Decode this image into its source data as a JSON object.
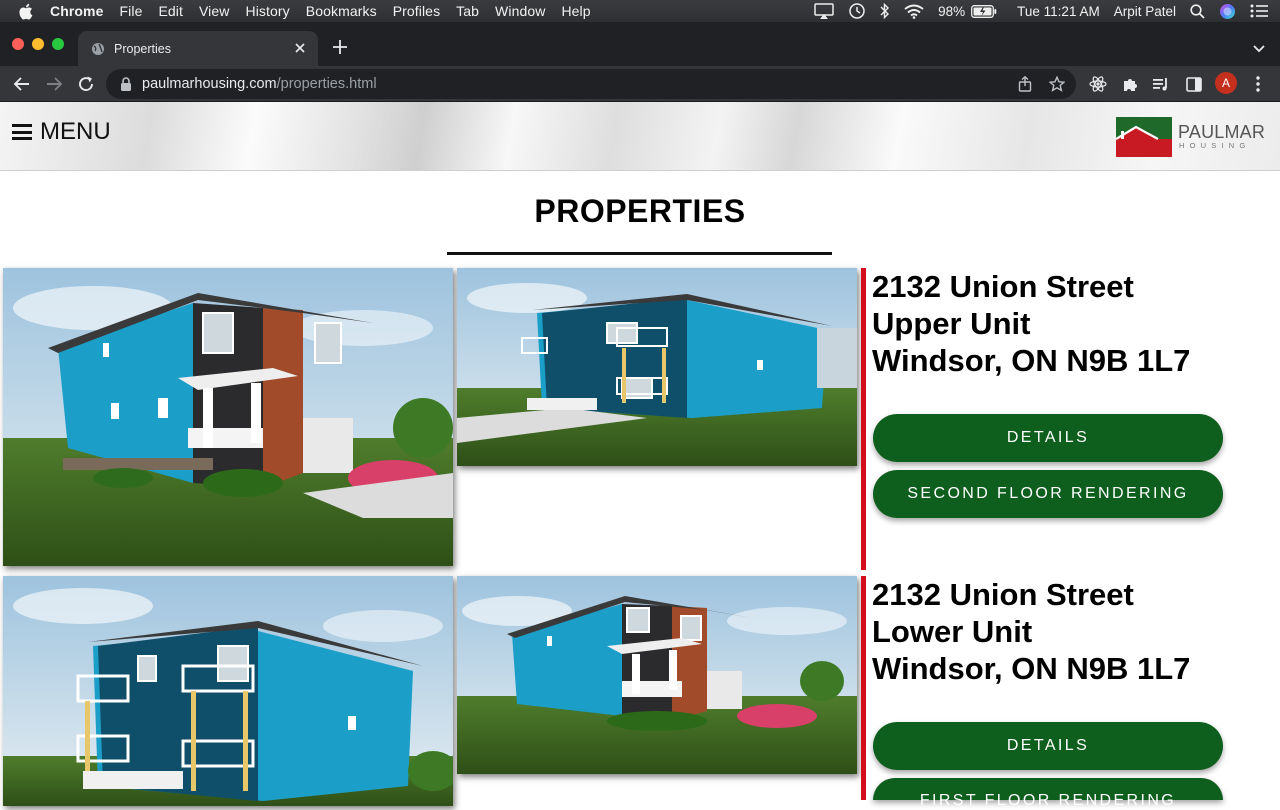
{
  "os_menubar": {
    "app": "Chrome",
    "items": [
      "File",
      "Edit",
      "View",
      "History",
      "Bookmarks",
      "Profiles",
      "Tab",
      "Window",
      "Help"
    ],
    "battery": "98%",
    "clock": "Tue 11:21 AM",
    "user": "Arpit Patel"
  },
  "browser": {
    "tab_title": "Properties",
    "url_host": "paulmarhousing.com",
    "url_path": "/properties.html",
    "avatar_letter": "A"
  },
  "site": {
    "menu_label": "MENU",
    "logo_brand": "PAULMAR",
    "logo_sub": "HOUSING",
    "page_title": "PROPERTIES"
  },
  "properties": [
    {
      "line1": "2132 Union Street",
      "line2": "Upper Unit",
      "line3": "Windsor, ON N9B 1L7",
      "button1": "DETAILS",
      "button2": "SECOND FLOOR RENDERING"
    },
    {
      "line1": "2132 Union Street",
      "line2": "Lower Unit",
      "line3": "Windsor, ON N9B 1L7",
      "button1": "DETAILS",
      "button2": "FIRST FLOOR RENDERING"
    }
  ],
  "colors": {
    "button_green": "#0e5e1e",
    "accent_red": "#d40d1d",
    "siding_blue": "#1b9fc9"
  }
}
